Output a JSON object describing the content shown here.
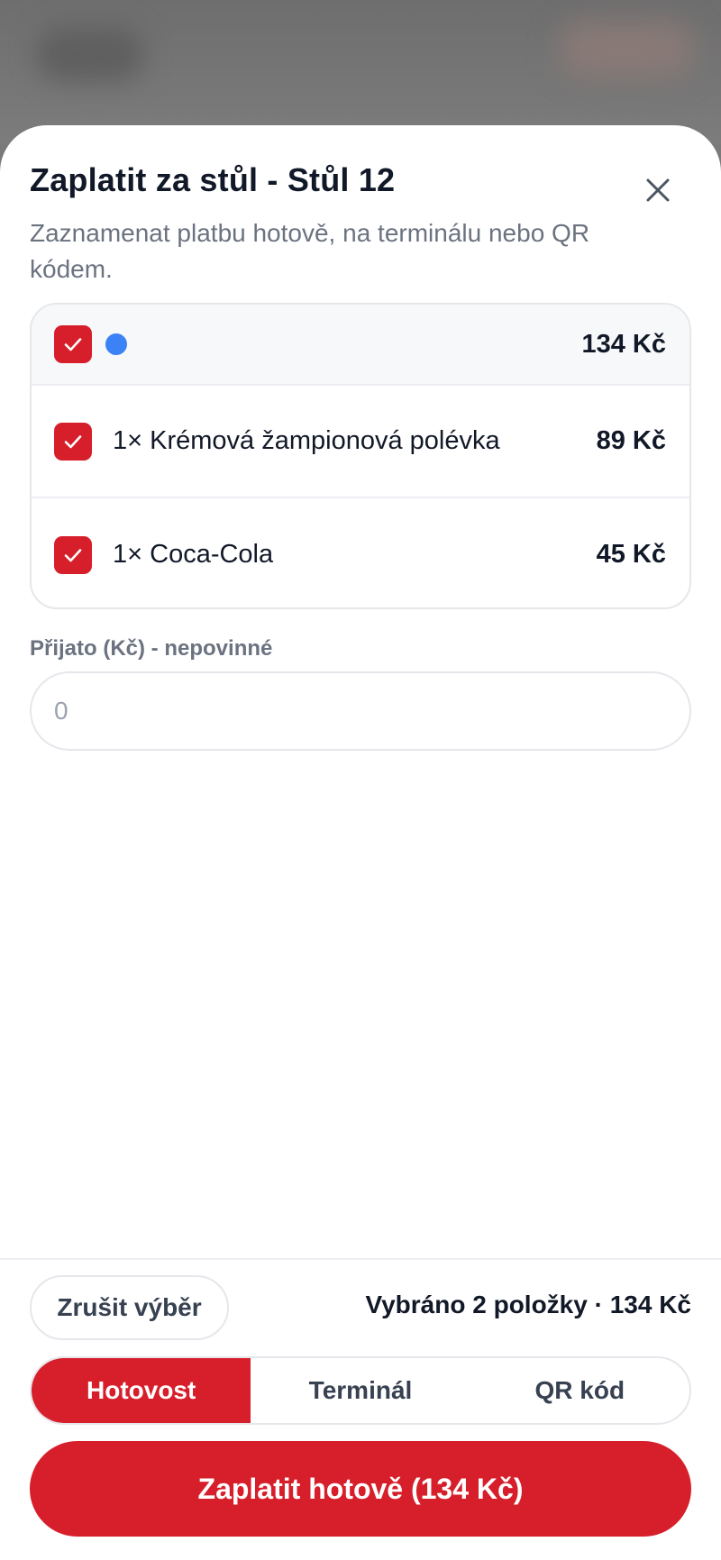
{
  "dialog": {
    "title": "Zaplatit za stůl - Stůl 12",
    "subtitle": "Zaznamenat platbu hotově, na terminálu nebo QR kódem."
  },
  "items": {
    "summary": {
      "price": "134 Kč",
      "checked": true,
      "dot_color": "#3b82f6"
    },
    "rows": [
      {
        "label": "1× Krémová žampionová polévka",
        "price": "89 Kč",
        "checked": true
      },
      {
        "label": "1× Coca-Cola",
        "price": "45 Kč",
        "checked": true
      }
    ]
  },
  "received": {
    "label": "Přijato (Kč) - nepovinné",
    "placeholder": "0",
    "value": ""
  },
  "footer": {
    "clear_label": "Zrušit výběr",
    "selected_summary": "Vybráno 2 položky · 134 Kč",
    "methods": [
      {
        "label": "Hotovost",
        "active": true
      },
      {
        "label": "Terminál",
        "active": false
      },
      {
        "label": "QR kód",
        "active": false
      }
    ],
    "pay_label": "Zaplatit hotově (134 Kč)"
  },
  "colors": {
    "accent": "#d71f2b",
    "text_primary": "#111827",
    "text_secondary": "#6b7280",
    "border": "#e5e7eb"
  },
  "icons": {
    "close": "close-icon",
    "check": "check-icon"
  }
}
